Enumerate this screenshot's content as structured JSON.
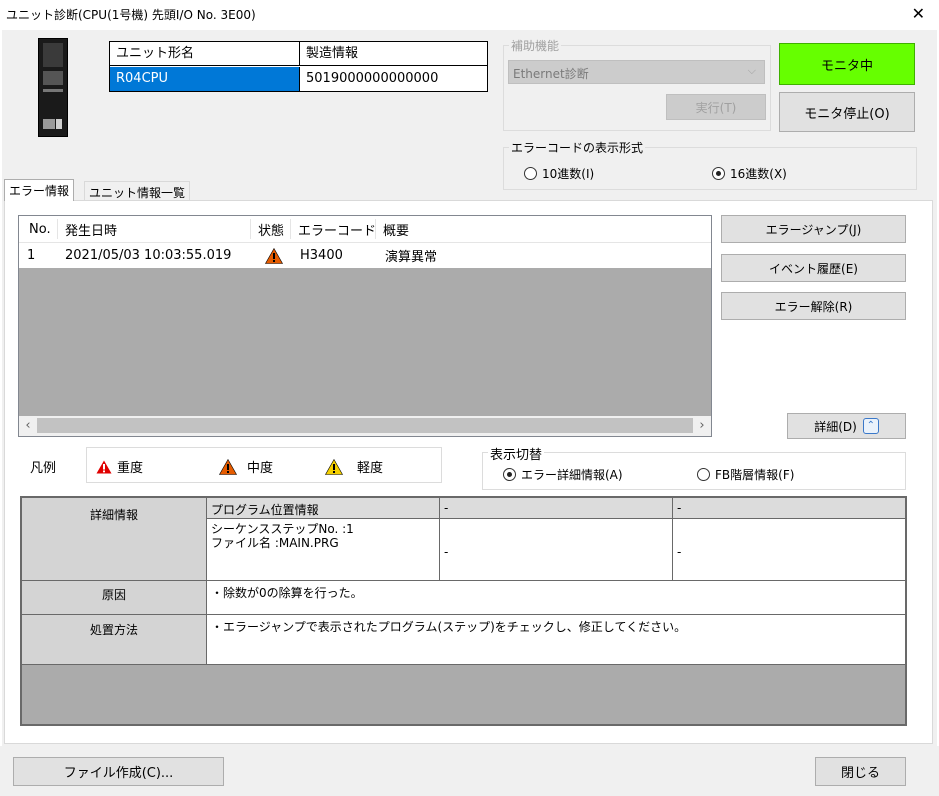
{
  "window": {
    "title": "ユニット診断(CPU(1号機) 先頭I/O No. 3E00)",
    "close_glyph": "✕"
  },
  "module_table": {
    "headers": [
      "ユニット形名",
      "製造情報"
    ],
    "model": "R04CPU",
    "production_info": "5019000000000000"
  },
  "aux_function": {
    "legend": "補助機能",
    "select_value": "Ethernet診断",
    "execute_label": "実行(T)"
  },
  "monitor": {
    "status_label": "モニタ中",
    "stop_label": "モニタ停止(O)",
    "status_color": "#66ff00"
  },
  "error_code_format": {
    "legend": "エラーコードの表示形式",
    "options": [
      "10進数(I)",
      "16進数(X)"
    ],
    "selected": "16進数(X)"
  },
  "tabs": [
    "エラー情報",
    "ユニット情報一覧"
  ],
  "error_list": {
    "columns": [
      "No.",
      "発生日時",
      "状態",
      "エラーコード",
      "概要"
    ],
    "rows": [
      {
        "no": "1",
        "datetime": "2021/05/03 10:03:55.019",
        "status_icon": "warning-moderate-icon",
        "code": "H3400",
        "summary": "演算異常"
      }
    ]
  },
  "side_buttons": {
    "error_jump": "エラージャンプ(J)",
    "event_history": "イベント履歴(E)",
    "error_clear": "エラー解除(R)",
    "detail": "詳細(D)"
  },
  "legend": {
    "label": "凡例",
    "items": [
      {
        "label": "重度",
        "icon": "warning-major-icon",
        "color": "#e00000"
      },
      {
        "label": "中度",
        "icon": "warning-moderate-icon",
        "color": "#e65c00"
      },
      {
        "label": "軽度",
        "icon": "warning-minor-icon",
        "color": "#f5d000"
      }
    ]
  },
  "display_switch": {
    "legend": "表示切替",
    "options": [
      "エラー詳細情報(A)",
      "FB階層情報(F)"
    ],
    "selected": "エラー詳細情報(A)"
  },
  "details": {
    "detail_label": "詳細情報",
    "program_position_header": "プログラム位置情報",
    "dash": "-",
    "sequence_step": "シーケンスステップNo. :1",
    "file_name": "ファイル名 :MAIN.PRG",
    "cause_label": "原因",
    "cause_text": "・除数が0の除算を行った。",
    "action_label": "処置方法",
    "action_text": "・エラージャンプで表示されたプログラム(ステップ)をチェックし、修正してください。"
  },
  "footer": {
    "file_create": "ファイル作成(C)...",
    "close": "閉じる"
  }
}
